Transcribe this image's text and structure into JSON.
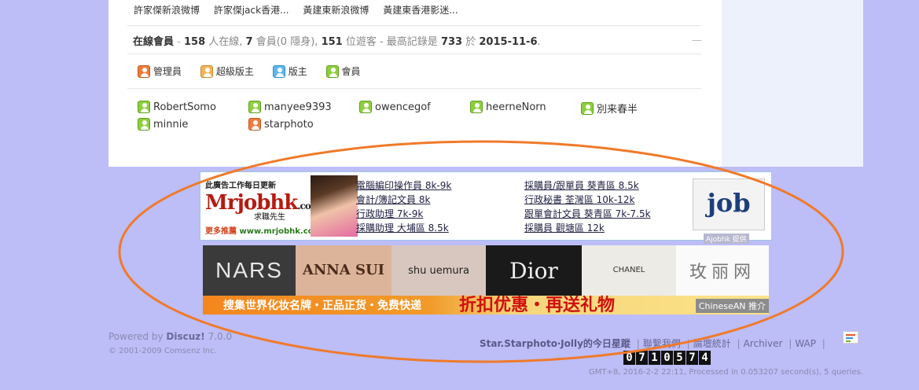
{
  "top_links": [
    "許家傑新浪微博",
    "許家傑jack香港...",
    "黃建東新浪微博",
    "黃建東香港影迷..."
  ],
  "online": {
    "label": "在線會員",
    "total": "158",
    "total_text": "人在線",
    "members": "7",
    "members_text": "會員(0 隱身),",
    "guests": "151",
    "guests_text": "位遊客 - 最高記錄是",
    "record": "733",
    "record_text": "於",
    "record_date": "2015-11-6",
    "collapse": "—"
  },
  "legend": [
    "管理員",
    "超級版主",
    "版主",
    "會員"
  ],
  "users": [
    {
      "name": "RobertSomo",
      "role": "member"
    },
    {
      "name": "manyee9393",
      "role": "member"
    },
    {
      "name": "owencegof",
      "role": "member"
    },
    {
      "name": "heerneNorn",
      "role": "member"
    },
    {
      "name": "別来春半",
      "role": "member"
    },
    {
      "name": "minnie",
      "role": "member"
    },
    {
      "name": "starphoto",
      "role": "admin"
    }
  ],
  "job_ad": {
    "header": "此廣告工作每日更新",
    "brand": "Mrjobhk",
    "brand_suffix": ".com",
    "brand_sub": "求職先生",
    "more": "更多推薦",
    "url": "www.mrjobhk.com",
    "jobs_left": [
      "電腦編印操作員 8k-9k",
      "會計/簿記文員 8k",
      "行政助理 7k-9k",
      "採購助理 大埔區 8.5k"
    ],
    "jobs_right": [
      "採購員/跟單員 葵青區 8.5k",
      "行政秘書 荃灣區 10k-12k",
      "跟單會計文員 葵青區 7k-7.5k",
      "採購員 觀塘區 12k"
    ],
    "logo_text": "job",
    "source": "Ajobhk 提供"
  },
  "cosmetics_ad": {
    "brands": [
      "NARS",
      "ANNA SUI",
      "shu uemura",
      "Dior",
      "CHANEL",
      "玫丽网"
    ],
    "slogan_left": "搜集世界化妆名牌・正品正货・免费快递",
    "slogan_right": "折扣优惠・再送礼物",
    "source": "ChineseAN 推介"
  },
  "footer": {
    "powered_prefix": "Powered by",
    "powered_product": "Discuz!",
    "powered_version": "7.0.0",
    "copyright": "© 2001-2009 Comsenz Inc.",
    "site_name": "Star.Starphoto‧Jolly的今日星蹤",
    "links": [
      "聯繫我們",
      "論壇統計",
      "Archiver",
      "WAP"
    ],
    "counter": "0710574",
    "gmt": "GMT+8, 2016-2-2 22:11, Processed in 0.053207 second(s), 5 queries."
  },
  "colors": {
    "page_bg": "#bdbdf7",
    "annotation": "#f07a2a"
  }
}
